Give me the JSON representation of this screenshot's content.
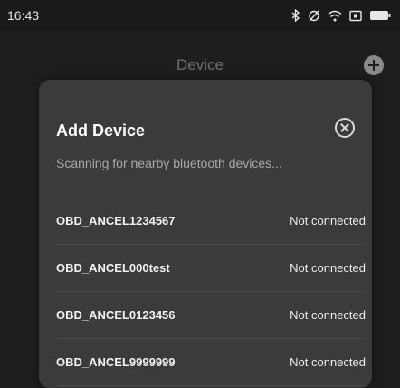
{
  "status_bar": {
    "time": "16:43",
    "icons": [
      "bluetooth-icon",
      "alarm-off-icon",
      "wifi-icon",
      "sim-icon",
      "battery-icon"
    ]
  },
  "header": {
    "title": "Device",
    "add_icon": "plus-circle-icon"
  },
  "dialog": {
    "title": "Add Device",
    "subtitle": "Scanning for nearby bluetooth devices...",
    "close_icon": "close-circle-icon",
    "devices": [
      {
        "name": "OBD_ANCEL1234567",
        "status": "Not connected"
      },
      {
        "name": "OBD_ANCEL000test",
        "status": "Not connected"
      },
      {
        "name": "OBD_ANCEL0123456",
        "status": "Not connected"
      },
      {
        "name": "OBD_ANCEL9999999",
        "status": "Not connected"
      }
    ]
  },
  "colors": {
    "background": "#1e1e1e",
    "dialog_bg": "#3b3b3b",
    "muted_text": "#a8a8a8"
  }
}
